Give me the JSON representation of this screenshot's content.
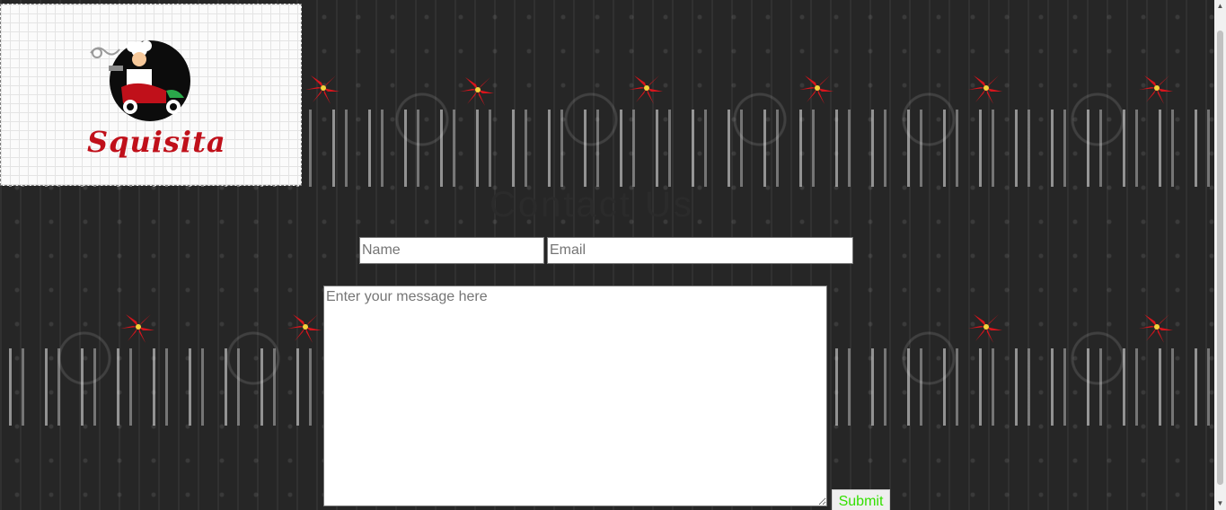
{
  "header": {
    "brand_name": "Squisita",
    "logo_icon": "chef-on-scooter-icon"
  },
  "contact": {
    "heading": "Contact Us",
    "name_placeholder": "Name",
    "email_placeholder": "Email",
    "message_placeholder": "Enter your message here",
    "submit_label": "Submit"
  },
  "theme": {
    "background": "#262626",
    "brand_red": "#c0101a",
    "submit_text": "#33e000",
    "flower_red": "#d9141c"
  }
}
